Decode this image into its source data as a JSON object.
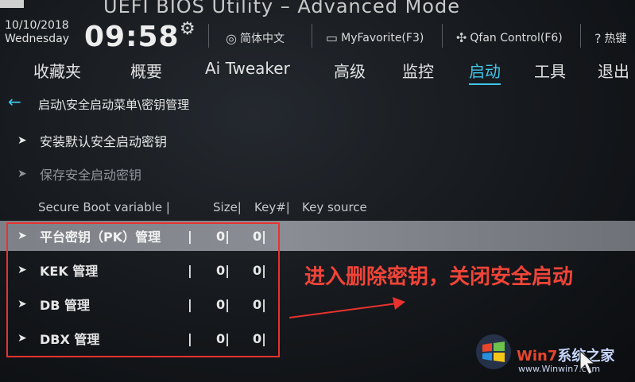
{
  "header": {
    "title": "UEFI BIOS Utility – Advanced Mode",
    "date": "10/10/2018",
    "weekday": "Wednesday",
    "time": "09:58",
    "language": "简体中文",
    "myfavorite": "MyFavorite(F3)",
    "qfan": "Qfan Control(F6)",
    "hotkeys": "热键"
  },
  "tabs": [
    {
      "label": "收藏夹",
      "active": false
    },
    {
      "label": "概要",
      "active": false
    },
    {
      "label": "Ai Tweaker",
      "active": false
    },
    {
      "label": "高级",
      "active": false
    },
    {
      "label": "监控",
      "active": false
    },
    {
      "label": "启动",
      "active": true
    },
    {
      "label": "工具",
      "active": false
    },
    {
      "label": "退出",
      "active": false
    }
  ],
  "breadcrumb": "启动\\安全启动菜单\\密钥管理",
  "menu": {
    "install_default": "安装默认安全启动密钥",
    "save_keys": "保存安全启动密钥"
  },
  "table": {
    "header": {
      "variable": "Secure Boot variable |",
      "size": "Size|",
      "keynum": "Key#|",
      "source": "Key source"
    },
    "rows": [
      {
        "name": "平台密钥（PK）管理",
        "sep": "|",
        "size": "0|",
        "keys": "0|"
      },
      {
        "name": "KEK 管理",
        "sep": "|",
        "size": "0|",
        "keys": "0|"
      },
      {
        "name": "DB 管理",
        "sep": "|",
        "size": "0|",
        "keys": "0|"
      },
      {
        "name": "DBX 管理",
        "sep": "|",
        "size": "0|",
        "keys": "0|"
      }
    ]
  },
  "annotation": "进入删除密钥，关闭安全启动",
  "watermark": {
    "brand_a": "Win7",
    "brand_b": "系统之家",
    "url": "www.Winwin7.com"
  },
  "colors": {
    "accent": "#3fc6e8",
    "annotation": "#f04438",
    "highlight": "#888c92"
  }
}
